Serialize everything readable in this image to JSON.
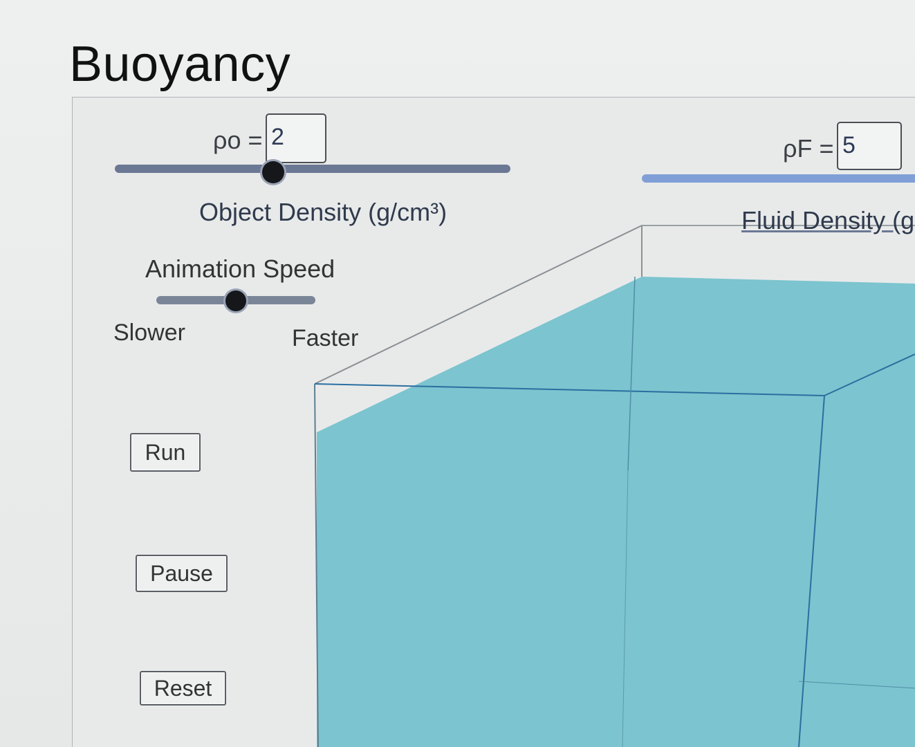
{
  "app": {
    "title": "Buoyancy"
  },
  "object_density": {
    "symbol": "ρo =",
    "value": "2",
    "label": "Object Density (g/cm³)",
    "slider_fraction": 0.4
  },
  "fluid_density": {
    "symbol": "ρF =",
    "value": "5",
    "label": "Fluid Density (g"
  },
  "animation_speed": {
    "label": "Animation Speed",
    "min_label": "Slower",
    "max_label": "Faster",
    "slider_fraction": 0.5
  },
  "buttons": {
    "run": "Run",
    "pause": "Pause",
    "reset": "Reset"
  },
  "colors": {
    "fluid": "#7cc4cf",
    "tank_edge": "#2a6fa0",
    "accent": "#7f9fd6"
  }
}
